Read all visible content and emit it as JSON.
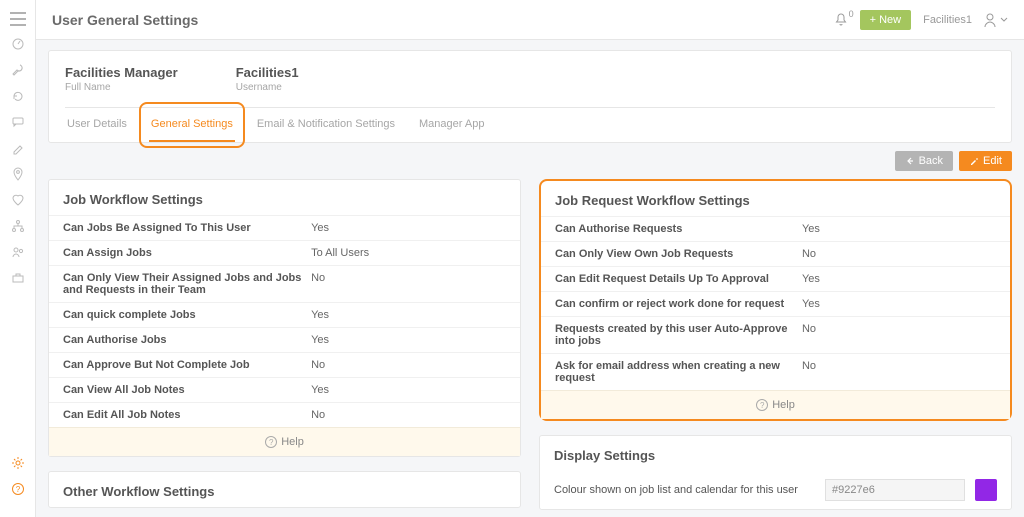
{
  "page_title": "User General Settings",
  "notifications_count": "0",
  "new_button": "+ New",
  "facility_name": "Facilities1",
  "header": {
    "fullname_value": "Facilities Manager",
    "fullname_label": "Full Name",
    "username_value": "Facilities1",
    "username_label": "Username"
  },
  "tabs": [
    "User Details",
    "General Settings",
    "Email & Notification Settings",
    "Manager App"
  ],
  "actions": {
    "back": "Back",
    "edit": "Edit"
  },
  "job_workflow": {
    "title": "Job Workflow Settings",
    "rows": [
      {
        "label": "Can Jobs Be Assigned To This User",
        "value": "Yes"
      },
      {
        "label": "Can Assign Jobs",
        "value": "To All Users"
      },
      {
        "label": "Can Only View Their Assigned Jobs and Jobs and Requests in their Team",
        "value": "No"
      },
      {
        "label": "Can quick complete Jobs",
        "value": "Yes"
      },
      {
        "label": "Can Authorise Jobs",
        "value": "Yes"
      },
      {
        "label": "Can Approve But Not Complete Job",
        "value": "No"
      },
      {
        "label": "Can View All Job Notes",
        "value": "Yes"
      },
      {
        "label": "Can Edit All Job Notes",
        "value": "No"
      }
    ],
    "help": "Help"
  },
  "other_workflow": {
    "title": "Other Workflow Settings"
  },
  "request_workflow": {
    "title": "Job Request Workflow Settings",
    "rows": [
      {
        "label": "Can Authorise Requests",
        "value": "Yes"
      },
      {
        "label": "Can Only View Own Job Requests",
        "value": "No"
      },
      {
        "label": "Can Edit Request Details Up To Approval",
        "value": "Yes"
      },
      {
        "label": "Can confirm or reject work done for request",
        "value": "Yes"
      },
      {
        "label": "Requests created by this user Auto-Approve into jobs",
        "value": "No"
      },
      {
        "label": "Ask for email address when creating a new request",
        "value": "No"
      }
    ],
    "help": "Help"
  },
  "display": {
    "title": "Display Settings",
    "color_label": "Colour shown on job list and calendar for this user",
    "color_value": "#9227e6"
  }
}
